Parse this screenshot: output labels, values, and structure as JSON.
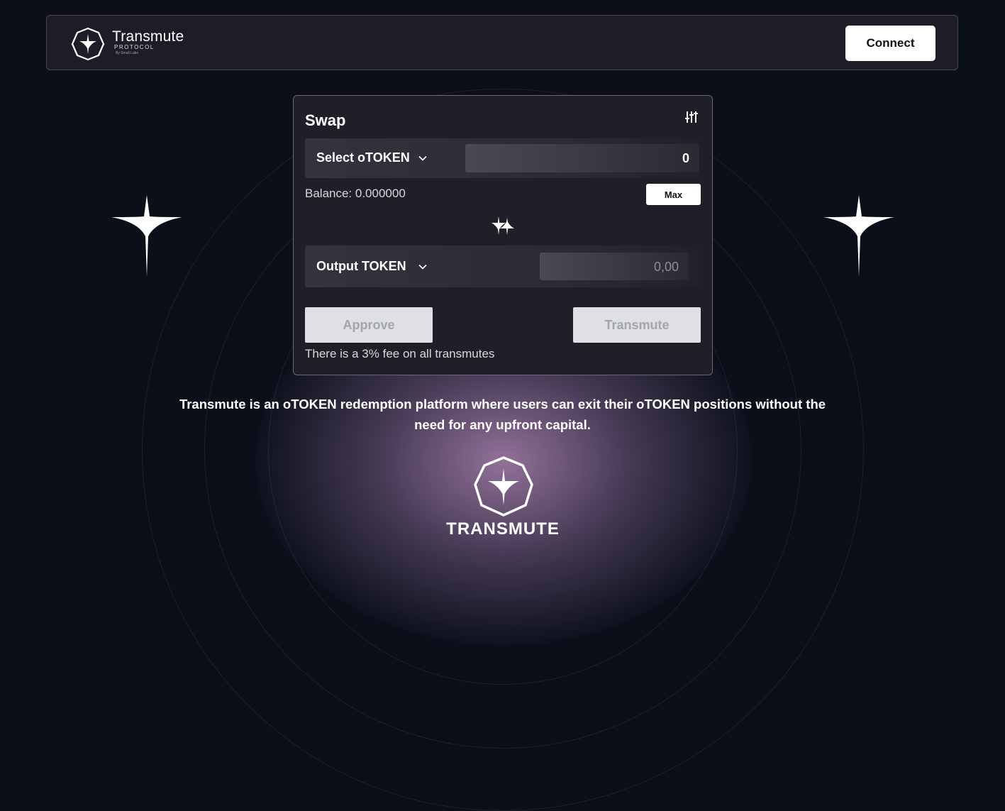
{
  "header": {
    "logo_title": "Transmute",
    "logo_subtitle": "PROTOCOL",
    "logo_by": "By Small Labs",
    "connect_label": "Connect"
  },
  "swap": {
    "title": "Swap",
    "input_token_label": "Select oTOKEN",
    "input_amount": "0",
    "balance_text": "Balance: 0.000000",
    "max_label": "Max",
    "output_token_label": "Output TOKEN",
    "output_amount": "0,00",
    "approve_label": "Approve",
    "transmute_label": "Transmute",
    "fee_note": "There is a 3% fee on all transmutes"
  },
  "description": "Transmute is an oTOKEN redemption platform where users can exit their oTOKEN positions without the need for any upfront capital.",
  "footer": {
    "wordmark": "TRANSMUTE"
  },
  "colors": {
    "background": "#0b0f1a",
    "card": "#201f28",
    "button_disabled": "#dfe0e3",
    "glow": "#a882af"
  },
  "icons": [
    "transmute-logo-icon",
    "settings-sliders-icon",
    "chevron-down-icon",
    "swap-stars-icon",
    "sparkle-star-icon"
  ]
}
